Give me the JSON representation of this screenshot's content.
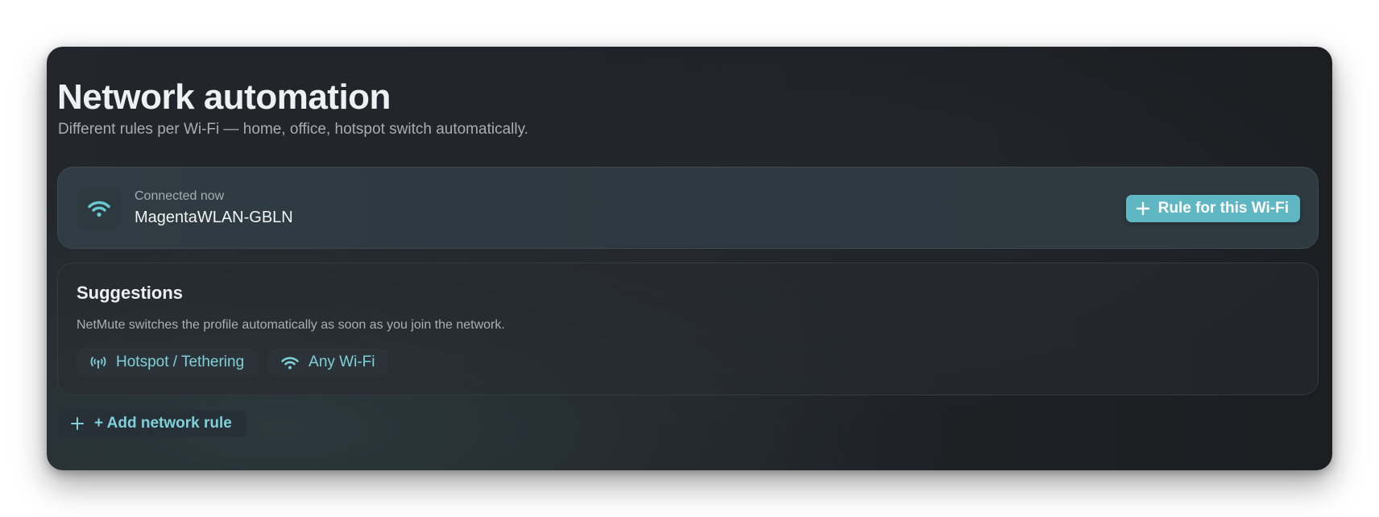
{
  "header": {
    "title": "Network automation",
    "subtitle": "Different rules per Wi-Fi — home, office, hotspot switch automatically."
  },
  "connected": {
    "label": "Connected now",
    "network_name": "MagentaWLAN-GBLN",
    "icon": "wifi-icon",
    "button_label": "Rule for this Wi-Fi"
  },
  "suggestions": {
    "title": "Suggestions",
    "description": "NetMute switches the profile automatically as soon as you join the network.",
    "chips": [
      {
        "label": "Hotspot / Tethering",
        "icon": "hotspot-icon"
      },
      {
        "label": "Any Wi-Fi",
        "icon": "wifi-icon"
      }
    ]
  },
  "add_rule": {
    "label": "+ Add network rule",
    "icon": "plus-icon"
  },
  "colors": {
    "accent": "#5fb7c3",
    "accent_text": "#7fd0da",
    "background": "#1f2226"
  }
}
